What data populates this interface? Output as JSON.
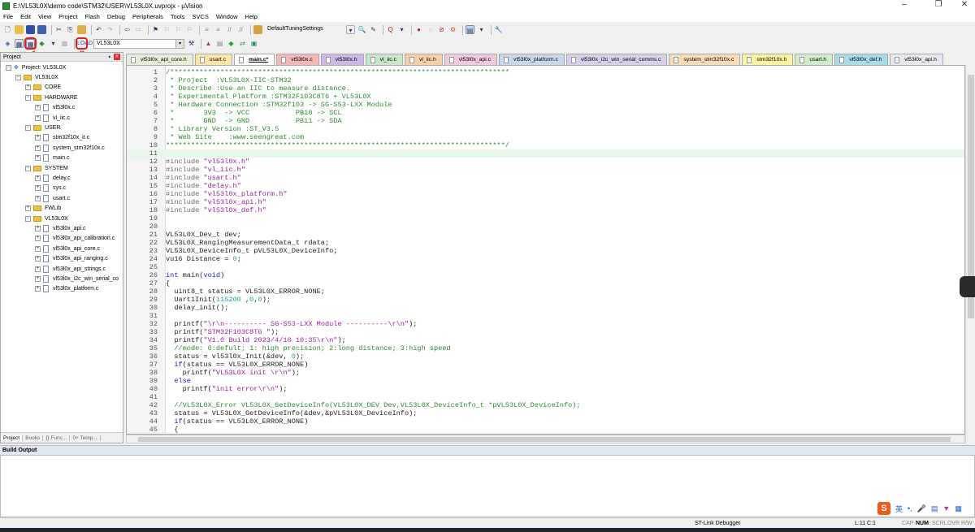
{
  "window": {
    "title": "E:\\VL53L0X\\demo code\\STM32\\USER\\VL53L0X.uvprojx - µVision"
  },
  "menu": [
    "File",
    "Edit",
    "View",
    "Project",
    "Flash",
    "Debug",
    "Peripherals",
    "Tools",
    "SVCS",
    "Window",
    "Help"
  ],
  "toolbar": {
    "tuning_settings": "DefaultTuningSettings",
    "target": "VL53L0X",
    "annotation_1": "1",
    "annotation_2": "2"
  },
  "project": {
    "header": "Project",
    "tree": [
      {
        "label": "Project: VL53L0X",
        "level": 0,
        "type": "root"
      },
      {
        "label": "VL53L0X",
        "level": 1,
        "type": "folder-open"
      },
      {
        "label": "CORE",
        "level": 2,
        "type": "folder"
      },
      {
        "label": "HARDWARE",
        "level": 2,
        "type": "folder-open"
      },
      {
        "label": "vl53l0x.c",
        "level": 3,
        "type": "file"
      },
      {
        "label": "vl_iic.c",
        "level": 3,
        "type": "file"
      },
      {
        "label": "USER",
        "level": 2,
        "type": "folder-open"
      },
      {
        "label": "stm32f10x_it.c",
        "level": 3,
        "type": "file"
      },
      {
        "label": "system_stm32f10x.c",
        "level": 3,
        "type": "file"
      },
      {
        "label": "main.c",
        "level": 3,
        "type": "file"
      },
      {
        "label": "SYSTEM",
        "level": 2,
        "type": "folder-open"
      },
      {
        "label": "delay.c",
        "level": 3,
        "type": "file"
      },
      {
        "label": "sys.c",
        "level": 3,
        "type": "file"
      },
      {
        "label": "usart.c",
        "level": 3,
        "type": "file"
      },
      {
        "label": "FWLib",
        "level": 2,
        "type": "folder"
      },
      {
        "label": "VL53L0X",
        "level": 2,
        "type": "folder-open"
      },
      {
        "label": "vl53l0x_api.c",
        "level": 3,
        "type": "file"
      },
      {
        "label": "vl53l0x_api_calibration.c",
        "level": 3,
        "type": "file"
      },
      {
        "label": "vl53l0x_api_core.c",
        "level": 3,
        "type": "file"
      },
      {
        "label": "vl53l0x_api_ranging.c",
        "level": 3,
        "type": "file"
      },
      {
        "label": "vl53l0x_api_strings.c",
        "level": 3,
        "type": "file"
      },
      {
        "label": "vl53l0x_i2c_win_serial_co",
        "level": 3,
        "type": "file"
      },
      {
        "label": "vl53l0x_platform.c",
        "level": 3,
        "type": "file"
      }
    ],
    "tabs": [
      "Project",
      "Books",
      "{} Func...",
      "0+ Temp..."
    ]
  },
  "file_tabs": [
    {
      "label": "vl53l0x_api_core.h",
      "color": "#e3efd8"
    },
    {
      "label": "usart.c",
      "color": "#f8e7a8"
    },
    {
      "label": "main.c*",
      "color": "#ffffff",
      "active": true
    },
    {
      "label": "vl53l0x.c",
      "color": "#f4b8b8"
    },
    {
      "label": "vl53l0x.h",
      "color": "#cdb8e8"
    },
    {
      "label": "vl_iic.c",
      "color": "#c8e6c8"
    },
    {
      "label": "vl_iic.h",
      "color": "#f8d0a8"
    },
    {
      "label": "vl53l0x_api.c",
      "color": "#f0c8e0"
    },
    {
      "label": "vl53l0x_platform.c",
      "color": "#c8d8ec"
    },
    {
      "label": "vl53l0x_i2c_win_serial_comms.c",
      "color": "#d8d0e8"
    },
    {
      "label": "system_stm32f10x.c",
      "color": "#f4dcb8"
    },
    {
      "label": "stm32f10x.h",
      "color": "#f8f4a0"
    },
    {
      "label": "usart.h",
      "color": "#d0ecc8"
    },
    {
      "label": "vl53l0x_def.h",
      "color": "#a8dce8"
    },
    {
      "label": "vl53l0x_api.h",
      "color": "#e8e8f0"
    }
  ],
  "editor": {
    "current_line": 11,
    "lines": [
      [
        [
          "/*********************************************************************************",
          "c"
        ]
      ],
      [
        [
          " * Project  :VL53L0X-IIC-STM32",
          "c"
        ]
      ],
      [
        [
          " * Describe :Use an IIC to measure distance.",
          "c"
        ]
      ],
      [
        [
          " * Experimental Platform :STM32F103C8T6 + VL53L0X",
          "c"
        ]
      ],
      [
        [
          " * Hardware Connection :STM32f103 -> SG-S53-LXX Module",
          "c"
        ]
      ],
      [
        [
          " *       3V3  -> VCC           PB10 -> SCL",
          "c"
        ]
      ],
      [
        [
          " *       GND  -> GND           PB11 -> SDA",
          "c"
        ]
      ],
      [
        [
          " * Library Version :ST_V3.5",
          "c"
        ]
      ],
      [
        [
          " * Web Site    :www.seengreat.com",
          "c"
        ]
      ],
      [
        [
          "*********************************************************************************/",
          "c"
        ]
      ],
      [],
      [
        [
          "#include ",
          "pp"
        ],
        [
          "\"vl53l0x.h\"",
          "s"
        ]
      ],
      [
        [
          "#include ",
          "pp"
        ],
        [
          "\"vl_iic.h\"",
          "s"
        ]
      ],
      [
        [
          "#include ",
          "pp"
        ],
        [
          "\"usart.h\"",
          "s"
        ]
      ],
      [
        [
          "#include ",
          "pp"
        ],
        [
          "\"delay.h\"",
          "s"
        ]
      ],
      [
        [
          "#include ",
          "pp"
        ],
        [
          "\"vl53l0x_platform.h\"",
          "s"
        ]
      ],
      [
        [
          "#include ",
          "pp"
        ],
        [
          "\"vl53l0x_api.h\"",
          "s"
        ]
      ],
      [
        [
          "#include ",
          "pp"
        ],
        [
          "\"vl53l0x_def.h\"",
          "s"
        ]
      ],
      [],
      [],
      [
        [
          "VL53L0X_Dev_t dev;",
          "p"
        ]
      ],
      [
        [
          "VL53L0X_RangingMeasurementData_t rdata;",
          "p"
        ]
      ],
      [
        [
          "VL53L0X_DeviceInfo_t pVL53L0X_DeviceInfo;",
          "p"
        ]
      ],
      [
        [
          "vu16 Distance = ",
          "p"
        ],
        [
          "0",
          "n"
        ],
        [
          ";",
          "p"
        ]
      ],
      [],
      [
        [
          "int ",
          "k"
        ],
        [
          "main(",
          "p"
        ],
        [
          "void",
          "k"
        ],
        [
          ")",
          "p"
        ]
      ],
      [
        [
          "{",
          "p"
        ]
      ],
      [
        [
          "  uint8_t status = VL53L0X_ERROR_NONE;",
          "p"
        ]
      ],
      [
        [
          "  Uart1Init(",
          "p"
        ],
        [
          "115200",
          "n"
        ],
        [
          " ,",
          "p"
        ],
        [
          "0",
          "n"
        ],
        [
          ",",
          "p"
        ],
        [
          "0",
          "n"
        ],
        [
          ");",
          "p"
        ]
      ],
      [
        [
          "  delay_init();",
          "p"
        ]
      ],
      [],
      [
        [
          "  printf(",
          "p"
        ],
        [
          "\"\\r\\n---------- SG-S53-LXX Module ----------\\r\\n\"",
          "s"
        ],
        [
          ");",
          "p"
        ]
      ],
      [
        [
          "  printf(",
          "p"
        ],
        [
          "\"STM32F103C8T6 \"",
          "s"
        ],
        [
          ");",
          "p"
        ]
      ],
      [
        [
          "  printf(",
          "p"
        ],
        [
          "\"V1.0 Build 2023/4/10 10:35\\r\\n\"",
          "s"
        ],
        [
          ");",
          "p"
        ]
      ],
      [
        [
          "  //mode: 0:defult; 1: high precision; 2:long distance; 3:high speed",
          "c"
        ]
      ],
      [
        [
          "  status = vl53l0x_Init(&dev, ",
          "p"
        ],
        [
          "0",
          "n"
        ],
        [
          ");",
          "p"
        ]
      ],
      [
        [
          "  if",
          "k"
        ],
        [
          "(status == VL53L0X_ERROR_NONE)",
          "p"
        ]
      ],
      [
        [
          "    printf(",
          "p"
        ],
        [
          "\"VL53L0X init \\r\\n\"",
          "s"
        ],
        [
          ");",
          "p"
        ]
      ],
      [
        [
          "  else",
          "k"
        ]
      ],
      [
        [
          "    printf(",
          "p"
        ],
        [
          "\"init error\\r\\n\"",
          "s"
        ],
        [
          ");",
          "p"
        ]
      ],
      [],
      [
        [
          "  //VL53L0X_Error VL53L0X_GetDeviceInfo(VL53L0X_DEV Dev,VL53L0X_DeviceInfo_t *pVL53L0X_DeviceInfo);",
          "c"
        ]
      ],
      [
        [
          "  status = VL53L0X_GetDeviceInfo(&dev,&pVL53L0X_DeviceInfo);",
          "p"
        ]
      ],
      [
        [
          "  if",
          "k"
        ],
        [
          "(status == VL53L0X_ERROR_NONE)",
          "p"
        ]
      ],
      [
        [
          "  {",
          "p"
        ]
      ]
    ]
  },
  "build_output": {
    "header": "Build Output"
  },
  "status": {
    "debugger": "ST-Link Debugger",
    "position": "L:11 C:1",
    "caps": "CAP",
    "num": "NUM",
    "scrl": "SCRL",
    "ovr": "OVR",
    "rw": "R/W"
  },
  "ime": {
    "logo": "S",
    "lang": "英"
  }
}
